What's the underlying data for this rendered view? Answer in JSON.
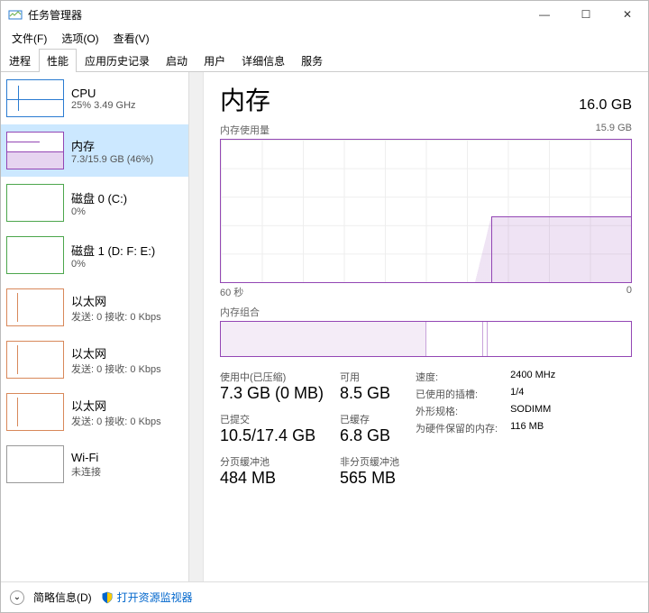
{
  "window": {
    "title": "任务管理器"
  },
  "window_buttons": {
    "minimize": "—",
    "maximize": "☐",
    "close": "✕"
  },
  "menu": {
    "file": "文件(F)",
    "options": "选项(O)",
    "view": "查看(V)"
  },
  "tabs": [
    "进程",
    "性能",
    "应用历史记录",
    "启动",
    "用户",
    "详细信息",
    "服务"
  ],
  "active_tab": "性能",
  "sidebar": [
    {
      "name": "cpu",
      "title": "CPU",
      "sub": "25%  3.49 GHz"
    },
    {
      "name": "mem",
      "title": "内存",
      "sub": "7.3/15.9 GB (46%)",
      "selected": true
    },
    {
      "name": "disk0",
      "title": "磁盘 0 (C:)",
      "sub": "0%"
    },
    {
      "name": "disk1",
      "title": "磁盘 1 (D: F: E:)",
      "sub": "0%"
    },
    {
      "name": "eth0",
      "title": "以太网",
      "sub": "发送: 0 接收: 0 Kbps"
    },
    {
      "name": "eth1",
      "title": "以太网",
      "sub": "发送: 0 接收: 0 Kbps"
    },
    {
      "name": "eth2",
      "title": "以太网",
      "sub": "发送: 0 接收: 0 Kbps"
    },
    {
      "name": "wifi",
      "title": "Wi-Fi",
      "sub": "未连接"
    }
  ],
  "header": {
    "title": "内存",
    "total": "16.0 GB"
  },
  "graph_label": {
    "name": "内存使用量",
    "max": "15.9 GB"
  },
  "axis": {
    "left": "60 秒",
    "right": "0"
  },
  "composition_label": "内存组合",
  "stats": {
    "col1": [
      {
        "l": "使用中(已压缩)",
        "v": "7.3 GB (0 MB)"
      },
      {
        "l": "已提交",
        "v": "10.5/17.4 GB"
      },
      {
        "l": "分页缓冲池",
        "v": "484 MB"
      }
    ],
    "col2": [
      {
        "l": "可用",
        "v": "8.5 GB"
      },
      {
        "l": "已缓存",
        "v": "6.8 GB"
      },
      {
        "l": "非分页缓冲池",
        "v": "565 MB"
      }
    ],
    "right": [
      {
        "k": "速度:",
        "v": "2400 MHz"
      },
      {
        "k": "已使用的插槽:",
        "v": "1/4"
      },
      {
        "k": "外形规格:",
        "v": "SODIMM"
      },
      {
        "k": "为硬件保留的内存:",
        "v": "116 MB"
      }
    ]
  },
  "footer": {
    "fewer": "简略信息(D)",
    "resmon": "打开资源监视器"
  },
  "chart_data": {
    "type": "area",
    "title": "内存使用量",
    "xlabel": "60 秒 → 0",
    "ylabel": "GB",
    "ylim": [
      0,
      15.9
    ],
    "x": [
      60,
      55,
      50,
      45,
      40,
      35,
      30,
      25,
      22,
      20,
      15,
      10,
      5,
      0
    ],
    "values": [
      0,
      0,
      0,
      0,
      0,
      0,
      0,
      0,
      0,
      7.3,
      7.3,
      7.3,
      7.3,
      7.3
    ]
  }
}
